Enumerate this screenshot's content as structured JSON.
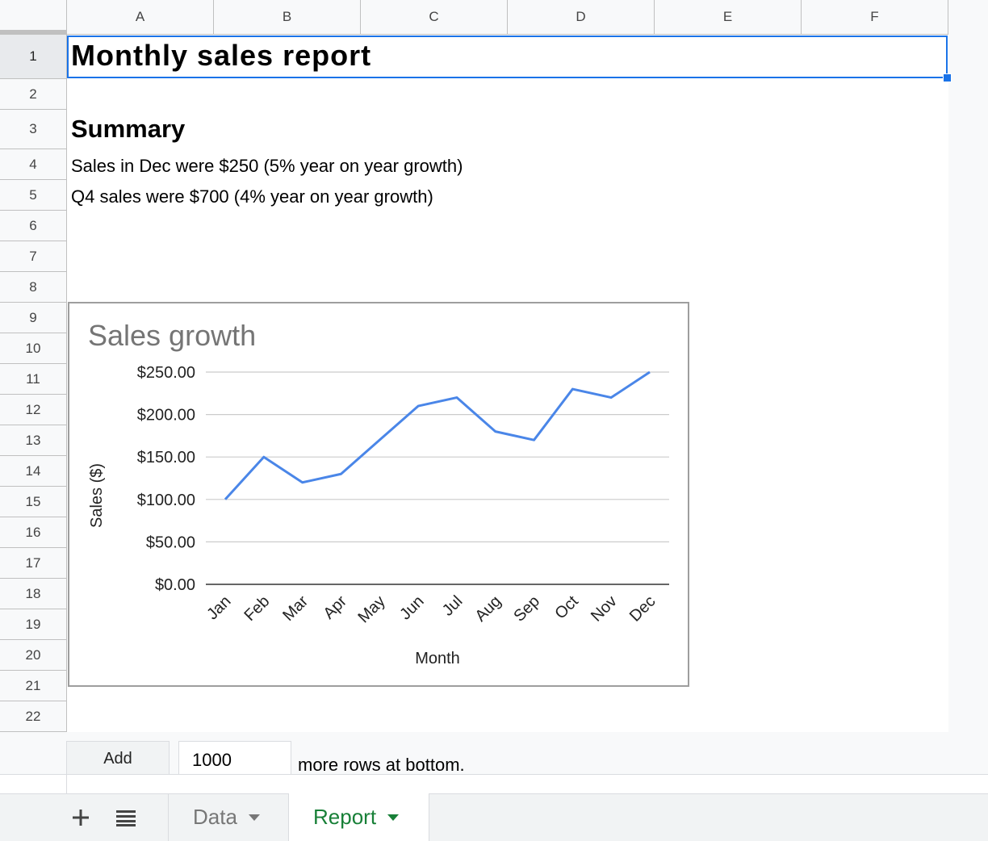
{
  "columns": [
    "A",
    "B",
    "C",
    "D",
    "E",
    "F"
  ],
  "rows": [
    "1",
    "2",
    "3",
    "4",
    "5",
    "6",
    "7",
    "8",
    "9",
    "10",
    "11",
    "12",
    "13",
    "14",
    "15",
    "16",
    "17",
    "18",
    "19",
    "20",
    "21",
    "22"
  ],
  "cells": {
    "a1": "Monthly sales report",
    "a3": "Summary",
    "a4": "Sales in Dec were $250 (5% year on year growth)",
    "a5": "Q4 sales were $700 (4% year on year growth)"
  },
  "add_rows": {
    "button_label": "Add",
    "count": "1000",
    "suffix": "more rows at bottom."
  },
  "sheet_tabs": {
    "add_icon": "plus-icon",
    "list_icon": "menu-list-icon",
    "tabs": [
      {
        "label": "Data",
        "active": false
      },
      {
        "label": "Report",
        "active": true
      }
    ]
  },
  "colors": {
    "line": "#4a86e8",
    "selection": "#1a73e8",
    "active_tab": "#188038"
  },
  "chart_data": {
    "type": "line",
    "title": "Sales growth",
    "xlabel": "Month",
    "ylabel": "Sales ($)",
    "categories": [
      "Jan",
      "Feb",
      "Mar",
      "Apr",
      "May",
      "Jun",
      "Jul",
      "Aug",
      "Sep",
      "Oct",
      "Nov",
      "Dec"
    ],
    "values": [
      100,
      150,
      120,
      130,
      170,
      210,
      220,
      180,
      170,
      230,
      220,
      250
    ],
    "yticks": [
      "$0.00",
      "$50.00",
      "$100.00",
      "$150.00",
      "$200.00",
      "$250.00"
    ],
    "ylim": [
      0,
      250
    ],
    "grid": true,
    "legend": "none"
  }
}
